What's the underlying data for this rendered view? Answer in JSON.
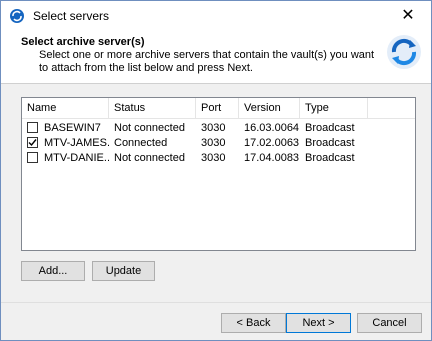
{
  "window": {
    "title": "Select servers",
    "close_glyph": "✕",
    "icon": "sync-icon"
  },
  "header": {
    "title": "Select archive server(s)",
    "description": "Select one or more archive servers that contain the vault(s) you want to attach from the list below and press Next.",
    "icon": "sync-arrows-icon"
  },
  "table": {
    "columns": [
      "Name",
      "Status",
      "Port",
      "Version",
      "Type"
    ],
    "rows": [
      {
        "checked": false,
        "name": "BASEWIN7",
        "status": "Not connected",
        "port": "3030",
        "version": "16.03.0064",
        "type": "Broadcast"
      },
      {
        "checked": true,
        "name": "MTV-JAMES...",
        "status": "Connected",
        "port": "3030",
        "version": "17.02.0063",
        "type": "Broadcast"
      },
      {
        "checked": false,
        "name": "MTV-DANIE...",
        "status": "Not connected",
        "port": "3030",
        "version": "17.04.0083",
        "type": "Broadcast"
      }
    ]
  },
  "buttons": {
    "add": "Add...",
    "update": "Update",
    "back": "< Back",
    "next": "Next >",
    "cancel": "Cancel"
  },
  "colors": {
    "accent": "#0078d7",
    "icon_blue": "#1565c0"
  }
}
